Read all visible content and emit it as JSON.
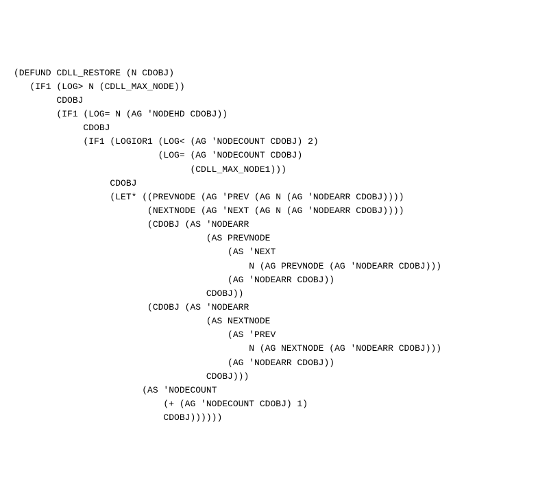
{
  "code": {
    "lines": [
      "(DEFUND CDLL_RESTORE (N CDOBJ)",
      "   (IF1 (LOG> N (CDLL_MAX_NODE))",
      "        CDOBJ",
      "        (IF1 (LOG= N (AG 'NODEHD CDOBJ))",
      "             CDOBJ",
      "             (IF1 (LOGIOR1 (LOG< (AG 'NODECOUNT CDOBJ) 2)",
      "                           (LOG= (AG 'NODECOUNT CDOBJ)",
      "                                 (CDLL_MAX_NODE1)))",
      "                  CDOBJ",
      "                  (LET* ((PREVNODE (AG 'PREV (AG N (AG 'NODEARR CDOBJ))))",
      "                         (NEXTNODE (AG 'NEXT (AG N (AG 'NODEARR CDOBJ))))",
      "                         (CDOBJ (AS 'NODEARR",
      "                                    (AS PREVNODE",
      "                                        (AS 'NEXT",
      "                                            N (AG PREVNODE (AG 'NODEARR CDOBJ)))",
      "                                        (AG 'NODEARR CDOBJ))",
      "                                    CDOBJ))",
      "                         (CDOBJ (AS 'NODEARR",
      "                                    (AS NEXTNODE",
      "                                        (AS 'PREV",
      "                                            N (AG NEXTNODE (AG 'NODEARR CDOBJ)))",
      "                                        (AG 'NODEARR CDOBJ))",
      "                                    CDOBJ)))",
      "                        (AS 'NODECOUNT",
      "                            (+ (AG 'NODECOUNT CDOBJ) 1)",
      "                            CDOBJ))))))"
    ]
  }
}
